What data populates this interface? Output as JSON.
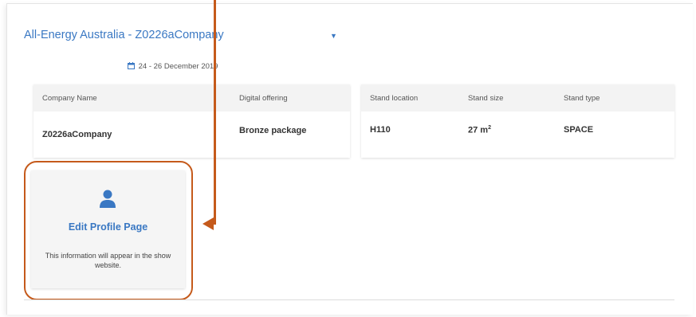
{
  "event": {
    "name": "All-Energy Australia - Z0226aCompany",
    "dates": "24 - 26 December 2019"
  },
  "company_table": {
    "headers": [
      "Company Name",
      "Digital offering"
    ],
    "row": [
      "Z0226aCompany",
      "Bronze package"
    ]
  },
  "stand_table": {
    "headers": [
      "Stand location",
      "Stand size",
      "Stand type"
    ],
    "location": "H110",
    "size_value": "27 m",
    "size_unit_sup": "2",
    "type": "SPACE"
  },
  "profile_card": {
    "title": "Edit Profile Page",
    "description": "This information will appear in the show website."
  },
  "colors": {
    "accent_blue": "#3a78c3",
    "annotation_orange": "#c55a1b"
  },
  "icons": [
    "chevron-down-icon",
    "calendar-icon",
    "user-icon"
  ]
}
